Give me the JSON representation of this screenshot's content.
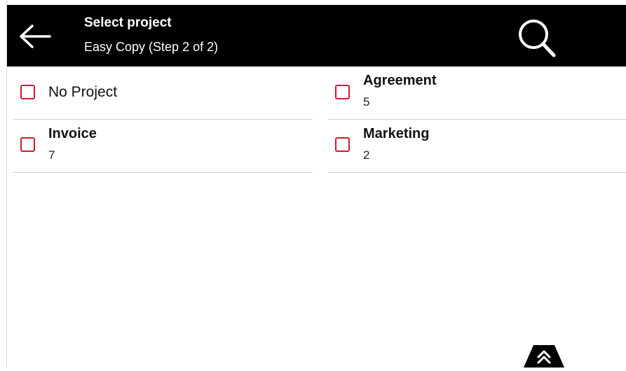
{
  "header": {
    "title": "Select project",
    "subtitle": "Easy Copy (Step 2 of 2)"
  },
  "projects": [
    {
      "name": "No Project",
      "count": ""
    },
    {
      "name": "Agreement",
      "count": "5"
    },
    {
      "name": "Invoice",
      "count": "7"
    },
    {
      "name": "Marketing",
      "count": "2"
    }
  ],
  "icons": {
    "back": "arrow-left-icon",
    "search": "search-icon",
    "scroll_top": "double-chevron-up-icon"
  },
  "colors": {
    "header_bg": "#000000",
    "checkbox_accent": "#d0192f"
  }
}
